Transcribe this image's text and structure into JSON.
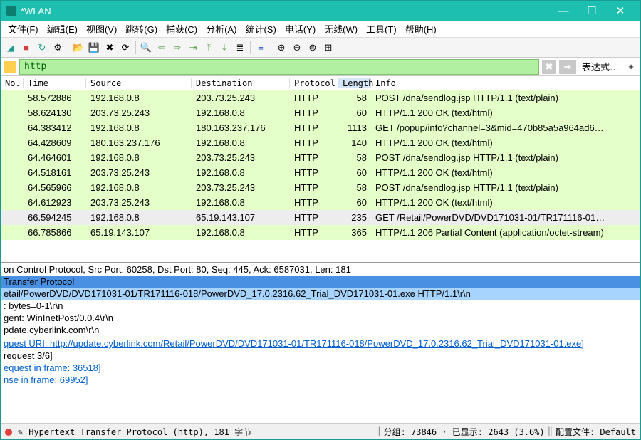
{
  "title": "*WLAN",
  "menus": [
    "文件(F)",
    "编辑(E)",
    "视图(V)",
    "跳转(G)",
    "捕获(C)",
    "分析(A)",
    "统计(S)",
    "电话(Y)",
    "无线(W)",
    "工具(T)",
    "帮助(H)"
  ],
  "filter": {
    "value": "http",
    "expr_label": "表达式…"
  },
  "columns": {
    "no": "No.",
    "time": "Time",
    "src": "Source",
    "dst": "Destination",
    "proto": "Protocol",
    "len": "Length",
    "info": "Info"
  },
  "packets": [
    {
      "time": "58.572886",
      "src": "192.168.0.8",
      "dst": "203.73.25.243",
      "proto": "HTTP",
      "len": "58",
      "info": "POST /dna/sendlog.jsp HTTP/1.1  (text/plain)",
      "cls": "bg-green"
    },
    {
      "time": "58.624130",
      "src": "203.73.25.243",
      "dst": "192.168.0.8",
      "proto": "HTTP",
      "len": "60",
      "info": "HTTP/1.1 200 OK  (text/html)",
      "cls": "bg-green"
    },
    {
      "time": "64.383412",
      "src": "192.168.0.8",
      "dst": "180.163.237.176",
      "proto": "HTTP",
      "len": "1113",
      "info": "GET /popup/info?channel=3&mid=470b85a5a964ad6…",
      "cls": "bg-green"
    },
    {
      "time": "64.428609",
      "src": "180.163.237.176",
      "dst": "192.168.0.8",
      "proto": "HTTP",
      "len": "140",
      "info": "HTTP/1.1 200 OK  (text/html)",
      "cls": "bg-green"
    },
    {
      "time": "64.464601",
      "src": "192.168.0.8",
      "dst": "203.73.25.243",
      "proto": "HTTP",
      "len": "58",
      "info": "POST /dna/sendlog.jsp HTTP/1.1  (text/plain)",
      "cls": "bg-green"
    },
    {
      "time": "64.518161",
      "src": "203.73.25.243",
      "dst": "192.168.0.8",
      "proto": "HTTP",
      "len": "60",
      "info": "HTTP/1.1 200 OK  (text/html)",
      "cls": "bg-green"
    },
    {
      "time": "64.565966",
      "src": "192.168.0.8",
      "dst": "203.73.25.243",
      "proto": "HTTP",
      "len": "58",
      "info": "POST /dna/sendlog.jsp HTTP/1.1  (text/plain)",
      "cls": "bg-green"
    },
    {
      "time": "64.612923",
      "src": "203.73.25.243",
      "dst": "192.168.0.8",
      "proto": "HTTP",
      "len": "60",
      "info": "HTTP/1.1 200 OK  (text/html)",
      "cls": "bg-green"
    },
    {
      "time": "66.594245",
      "src": "192.168.0.8",
      "dst": "65.19.143.107",
      "proto": "HTTP",
      "len": "235",
      "info": "GET /Retail/PowerDVD/DVD171031-01/TR171116-01…",
      "cls": "bg-sel"
    },
    {
      "time": "66.785866",
      "src": "65.19.143.107",
      "dst": "192.168.0.8",
      "proto": "HTTP",
      "len": "365",
      "info": "HTTP/1.1 206 Partial Content  (application/octet-stream)",
      "cls": "bg-green"
    }
  ],
  "details": [
    {
      "text": "on Control Protocol, Src Port: 60258, Dst Port: 80, Seq: 445, Ack: 6587031, Len: 181",
      "cls": ""
    },
    {
      "text": "Transfer Protocol",
      "cls": "d-blue"
    },
    {
      "text": "etail/PowerDVD/DVD171031-01/TR171116-018/PowerDVD_17.0.2316.62_Trial_DVD171031-01.exe HTTP/1.1\\r\\n",
      "cls": "d-lblue"
    },
    {
      "text": ": bytes=0-1\\r\\n",
      "cls": ""
    },
    {
      "text": "gent: WinInetPost/0.0.4\\r\\n",
      "cls": ""
    },
    {
      "text": "pdate.cyberlink.com\\r\\n",
      "cls": ""
    },
    {
      "text": "",
      "cls": ""
    },
    {
      "text": "quest URI: http://update.cyberlink.com/Retail/PowerDVD/DVD171031-01/TR171116-018/PowerDVD_17.0.2316.62_Trial_DVD171031-01.exe]",
      "cls": "d-link"
    },
    {
      "text": "request 3/6]",
      "cls": ""
    },
    {
      "text": "equest in frame: 36518]",
      "cls": "d-link"
    },
    {
      "text": "nse in frame: 69952]",
      "cls": "d-link"
    }
  ],
  "status": {
    "proto": "Hypertext Transfer Protocol (http), 181 字节",
    "packets": "分组: 73846 · 已显示: 2643 (3.6%)",
    "profile": "配置文件: Default"
  },
  "winbtns": {
    "min": "—",
    "max": "☐",
    "close": "✕"
  }
}
